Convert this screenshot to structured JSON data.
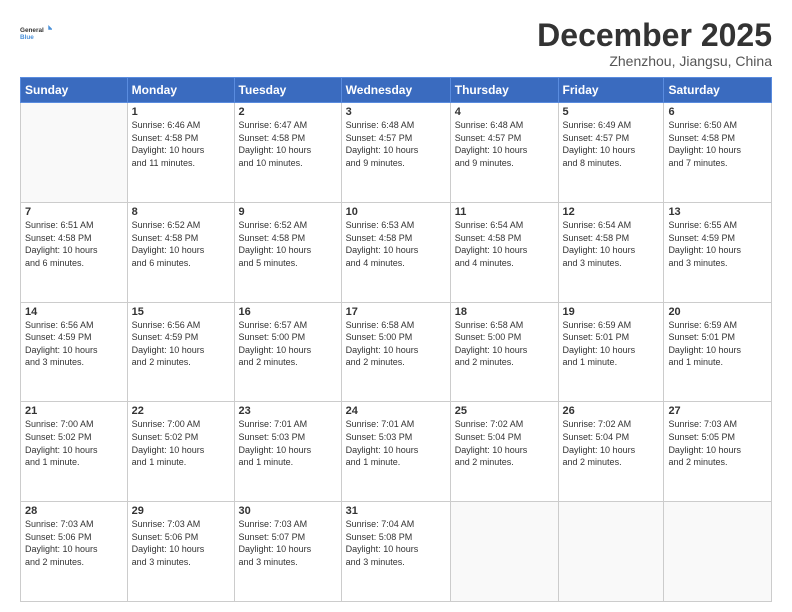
{
  "logo": {
    "general": "General",
    "blue": "Blue"
  },
  "header": {
    "month": "December 2025",
    "location": "Zhenzhou, Jiangsu, China"
  },
  "weekdays": [
    "Sunday",
    "Monday",
    "Tuesday",
    "Wednesday",
    "Thursday",
    "Friday",
    "Saturday"
  ],
  "weeks": [
    [
      {
        "day": "",
        "info": ""
      },
      {
        "day": "1",
        "info": "Sunrise: 6:46 AM\nSunset: 4:58 PM\nDaylight: 10 hours\nand 11 minutes."
      },
      {
        "day": "2",
        "info": "Sunrise: 6:47 AM\nSunset: 4:58 PM\nDaylight: 10 hours\nand 10 minutes."
      },
      {
        "day": "3",
        "info": "Sunrise: 6:48 AM\nSunset: 4:57 PM\nDaylight: 10 hours\nand 9 minutes."
      },
      {
        "day": "4",
        "info": "Sunrise: 6:48 AM\nSunset: 4:57 PM\nDaylight: 10 hours\nand 9 minutes."
      },
      {
        "day": "5",
        "info": "Sunrise: 6:49 AM\nSunset: 4:57 PM\nDaylight: 10 hours\nand 8 minutes."
      },
      {
        "day": "6",
        "info": "Sunrise: 6:50 AM\nSunset: 4:58 PM\nDaylight: 10 hours\nand 7 minutes."
      }
    ],
    [
      {
        "day": "7",
        "info": "Sunrise: 6:51 AM\nSunset: 4:58 PM\nDaylight: 10 hours\nand 6 minutes."
      },
      {
        "day": "8",
        "info": "Sunrise: 6:52 AM\nSunset: 4:58 PM\nDaylight: 10 hours\nand 6 minutes."
      },
      {
        "day": "9",
        "info": "Sunrise: 6:52 AM\nSunset: 4:58 PM\nDaylight: 10 hours\nand 5 minutes."
      },
      {
        "day": "10",
        "info": "Sunrise: 6:53 AM\nSunset: 4:58 PM\nDaylight: 10 hours\nand 4 minutes."
      },
      {
        "day": "11",
        "info": "Sunrise: 6:54 AM\nSunset: 4:58 PM\nDaylight: 10 hours\nand 4 minutes."
      },
      {
        "day": "12",
        "info": "Sunrise: 6:54 AM\nSunset: 4:58 PM\nDaylight: 10 hours\nand 3 minutes."
      },
      {
        "day": "13",
        "info": "Sunrise: 6:55 AM\nSunset: 4:59 PM\nDaylight: 10 hours\nand 3 minutes."
      }
    ],
    [
      {
        "day": "14",
        "info": "Sunrise: 6:56 AM\nSunset: 4:59 PM\nDaylight: 10 hours\nand 3 minutes."
      },
      {
        "day": "15",
        "info": "Sunrise: 6:56 AM\nSunset: 4:59 PM\nDaylight: 10 hours\nand 2 minutes."
      },
      {
        "day": "16",
        "info": "Sunrise: 6:57 AM\nSunset: 5:00 PM\nDaylight: 10 hours\nand 2 minutes."
      },
      {
        "day": "17",
        "info": "Sunrise: 6:58 AM\nSunset: 5:00 PM\nDaylight: 10 hours\nand 2 minutes."
      },
      {
        "day": "18",
        "info": "Sunrise: 6:58 AM\nSunset: 5:00 PM\nDaylight: 10 hours\nand 2 minutes."
      },
      {
        "day": "19",
        "info": "Sunrise: 6:59 AM\nSunset: 5:01 PM\nDaylight: 10 hours\nand 1 minute."
      },
      {
        "day": "20",
        "info": "Sunrise: 6:59 AM\nSunset: 5:01 PM\nDaylight: 10 hours\nand 1 minute."
      }
    ],
    [
      {
        "day": "21",
        "info": "Sunrise: 7:00 AM\nSunset: 5:02 PM\nDaylight: 10 hours\nand 1 minute."
      },
      {
        "day": "22",
        "info": "Sunrise: 7:00 AM\nSunset: 5:02 PM\nDaylight: 10 hours\nand 1 minute."
      },
      {
        "day": "23",
        "info": "Sunrise: 7:01 AM\nSunset: 5:03 PM\nDaylight: 10 hours\nand 1 minute."
      },
      {
        "day": "24",
        "info": "Sunrise: 7:01 AM\nSunset: 5:03 PM\nDaylight: 10 hours\nand 1 minute."
      },
      {
        "day": "25",
        "info": "Sunrise: 7:02 AM\nSunset: 5:04 PM\nDaylight: 10 hours\nand 2 minutes."
      },
      {
        "day": "26",
        "info": "Sunrise: 7:02 AM\nSunset: 5:04 PM\nDaylight: 10 hours\nand 2 minutes."
      },
      {
        "day": "27",
        "info": "Sunrise: 7:03 AM\nSunset: 5:05 PM\nDaylight: 10 hours\nand 2 minutes."
      }
    ],
    [
      {
        "day": "28",
        "info": "Sunrise: 7:03 AM\nSunset: 5:06 PM\nDaylight: 10 hours\nand 2 minutes."
      },
      {
        "day": "29",
        "info": "Sunrise: 7:03 AM\nSunset: 5:06 PM\nDaylight: 10 hours\nand 3 minutes."
      },
      {
        "day": "30",
        "info": "Sunrise: 7:03 AM\nSunset: 5:07 PM\nDaylight: 10 hours\nand 3 minutes."
      },
      {
        "day": "31",
        "info": "Sunrise: 7:04 AM\nSunset: 5:08 PM\nDaylight: 10 hours\nand 3 minutes."
      },
      {
        "day": "",
        "info": ""
      },
      {
        "day": "",
        "info": ""
      },
      {
        "day": "",
        "info": ""
      }
    ]
  ]
}
